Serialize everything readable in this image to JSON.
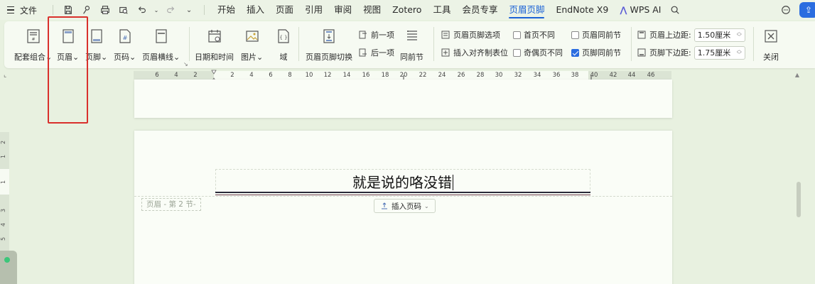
{
  "menubar": {
    "file": "文件",
    "tabs": [
      {
        "label": "开始"
      },
      {
        "label": "插入"
      },
      {
        "label": "页面"
      },
      {
        "label": "引用"
      },
      {
        "label": "审阅"
      },
      {
        "label": "视图"
      },
      {
        "label": "Zotero"
      },
      {
        "label": "工具"
      },
      {
        "label": "会员专享"
      },
      {
        "label": "页眉页脚",
        "active": true
      },
      {
        "label": "EndNote X9"
      }
    ],
    "wps_ai": "WPS AI",
    "icons": [
      "save-icon",
      "format-painter-icon",
      "print-icon",
      "print-preview-icon",
      "undo-icon",
      "redo-icon",
      "more-icon",
      "search-icon",
      "feedback-icon",
      "cloud-share-icon"
    ]
  },
  "ribbon": {
    "buttons": {
      "combo": "配套组合",
      "header": "页眉",
      "footer": "页脚",
      "page_number": "页码",
      "header_line": "页眉横线",
      "datetime": "日期和时间",
      "picture": "图片",
      "field": "域",
      "switch": "页眉页脚切换",
      "same_as_prev": "同前节",
      "close": "关闭"
    },
    "small": {
      "options": "页眉页脚选项",
      "align_tab": "插入对齐制表位",
      "prev": "前一项",
      "next": "后一项",
      "first_page_diff": "首页不同",
      "odd_even_diff": "奇偶页不同",
      "header_same_prev": "页眉同前节",
      "footer_same_prev": "页脚同前节",
      "header_top_margin_label": "页眉上边距:",
      "header_top_margin_value": "1.50厘米",
      "footer_bottom_margin_label": "页脚下边距:",
      "footer_bottom_margin_value": "1.75厘米"
    },
    "checks": {
      "first_page_diff": false,
      "odd_even_diff": false,
      "header_same_prev": false,
      "footer_same_prev": true
    },
    "accent": "#2b6de0",
    "highlight_frame_color": "#d9302c"
  },
  "ruler": {
    "numbers": [
      "6",
      "4",
      "2",
      "2",
      "4",
      "6",
      "8",
      "10",
      "12",
      "14",
      "16",
      "18",
      "20",
      "22",
      "24",
      "26",
      "28",
      "30",
      "32",
      "34",
      "36",
      "38",
      "40",
      "42",
      "44",
      "46"
    ]
  },
  "vruler": {
    "numbers": [
      "2",
      "1",
      "1",
      "3",
      "4",
      "5",
      "6",
      "7"
    ]
  },
  "document": {
    "header_text": "就是说的咯没错",
    "section_tag": "页眉 - 第 2 节-",
    "insert_page_number": "插入页码"
  }
}
